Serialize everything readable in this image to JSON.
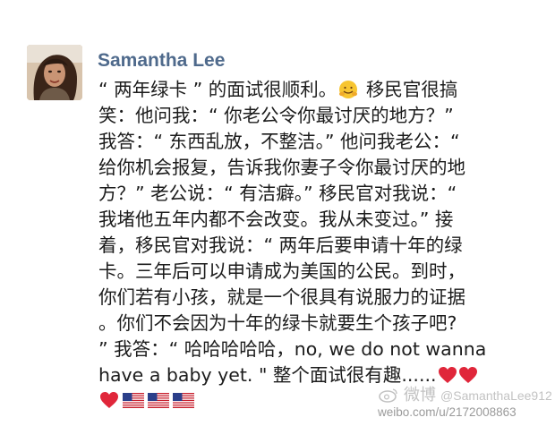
{
  "post": {
    "author": "Samantha Lee",
    "avatar_icon": "profile-photo",
    "lines": [
      "“ 两年绿卡 ” 的面试很顺利。",
      "笑：他问我：“ 你老公令你最讨厌的地方？”",
      "我答：“ 东西乱放，不整洁。” 他问我老公：“",
      "给你机会报复，告诉我你妻子令你最讨厌的地",
      "方？” 老公说：“ 有洁癖。” 移民官对我说：“",
      "我堵他五年内都不会改变。我从未变过。” 接",
      "着，移民官对我说：“ 两年后要申请十年的绿",
      "卡。三年后可以申请成为美国的公民。到时，",
      "你们若有小孩，就是一个很具有说服力的证据",
      "。你们不会因为十年的绿卡就要生个孩子吧?",
      "” 我答：“ 哈哈哈哈哈，no, we do not wanna",
      "have a baby yet. \" 整个面试很有趣......"
    ],
    "line1_suffix": " 移民官很搞",
    "emoji_names": [
      "hugging-face-emoji",
      "red-heart-emoji",
      "us-flag-emoji"
    ]
  },
  "watermark": {
    "logo_text": "微博",
    "handle": "@SamanthaLee912",
    "url": "weibo.com/u/2172008863"
  },
  "colors": {
    "username": "#4f6a8c",
    "text": "#1c1c1c",
    "heart": "#e0263a",
    "watermark": "#b8b8b8"
  }
}
